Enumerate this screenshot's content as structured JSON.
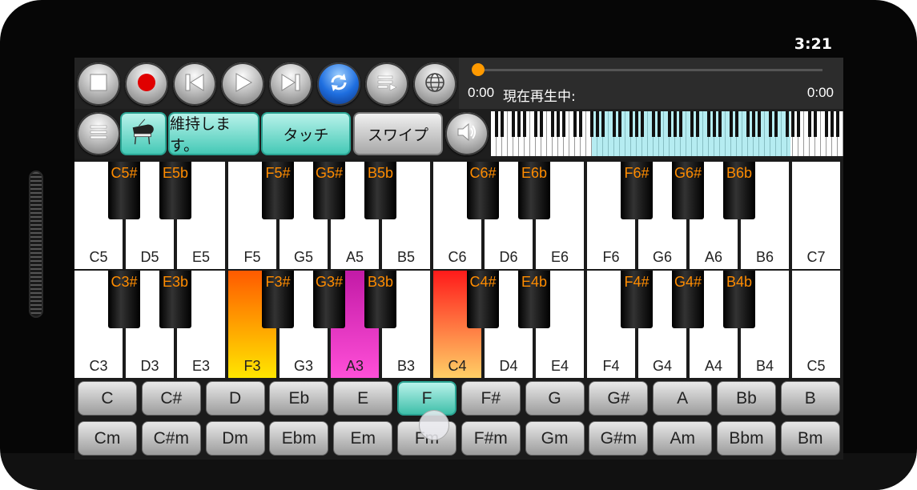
{
  "status_bar": {
    "time": "3:21"
  },
  "toolbar": {
    "buttons": [
      {
        "name": "stop-button",
        "icon": "stop-icon"
      },
      {
        "name": "record-button",
        "icon": "record-icon"
      },
      {
        "name": "previous-button",
        "icon": "skip-previous-icon"
      },
      {
        "name": "play-button",
        "icon": "play-icon"
      },
      {
        "name": "next-button",
        "icon": "skip-next-icon"
      },
      {
        "name": "repeat-button",
        "icon": "repeat-icon"
      },
      {
        "name": "playlist-button",
        "icon": "playlist-icon"
      },
      {
        "name": "web-button",
        "icon": "globe-icon"
      }
    ]
  },
  "player": {
    "time_elapsed": "0:00",
    "now_playing": "現在再生中:",
    "time_total": "0:00",
    "progress": 0
  },
  "controls": {
    "menu_icon": "menu-icon",
    "instrument_icon": "grand-piano-icon",
    "sustain_label": "維持します。",
    "touch_label": "タッチ",
    "swipe_label": "スワイプ",
    "volume_icon": "speaker-icon"
  },
  "keyboard_upper": {
    "white": [
      "C5",
      "D5",
      "E5",
      "F5",
      "G5",
      "A5",
      "B5",
      "C6",
      "D6",
      "E6",
      "F6",
      "G6",
      "A6",
      "B6",
      "C7"
    ],
    "black": [
      {
        "label": "C5#",
        "after": 0
      },
      {
        "label": "E5b",
        "after": 1
      },
      {
        "label": "F5#",
        "after": 3
      },
      {
        "label": "G5#",
        "after": 4
      },
      {
        "label": "B5b",
        "after": 5
      },
      {
        "label": "C6#",
        "after": 7
      },
      {
        "label": "E6b",
        "after": 8
      },
      {
        "label": "F6#",
        "after": 10
      },
      {
        "label": "G6#",
        "after": 11
      },
      {
        "label": "B6b",
        "after": 12
      }
    ]
  },
  "keyboard_lower": {
    "white": [
      "C3",
      "D3",
      "E3",
      "F3",
      "G3",
      "A3",
      "B3",
      "C4",
      "D4",
      "E4",
      "F4",
      "G4",
      "A4",
      "B4",
      "C5"
    ],
    "black": [
      {
        "label": "C3#",
        "after": 0
      },
      {
        "label": "E3b",
        "after": 1
      },
      {
        "label": "F3#",
        "after": 3
      },
      {
        "label": "G3#",
        "after": 4
      },
      {
        "label": "B3b",
        "after": 5
      },
      {
        "label": "C4#",
        "after": 7
      },
      {
        "label": "E4b",
        "after": 8
      },
      {
        "label": "F4#",
        "after": 10
      },
      {
        "label": "G4#",
        "after": 11
      },
      {
        "label": "B4b",
        "after": 12
      }
    ],
    "highlighted": {
      "F3": [
        "#ff5a00",
        "#ffe600"
      ],
      "A3": [
        "#c21aa6",
        "#ff4fd8"
      ],
      "C4": [
        "#ff1a1a",
        "#ffcf66"
      ]
    }
  },
  "chords_major": [
    "C",
    "C#",
    "D",
    "Eb",
    "E",
    "F",
    "F#",
    "G",
    "G#",
    "A",
    "Bb",
    "B"
  ],
  "chords_minor": [
    "Cm",
    "C#m",
    "Dm",
    "Ebm",
    "Em",
    "Fm",
    "F#m",
    "Gm",
    "G#m",
    "Am",
    "Bbm",
    "Bm"
  ],
  "selected_chord": "F",
  "colors": {
    "accent_teal": "#45c9b6",
    "black_key_label": "#ff8c00",
    "progress_dot": "#ff9a00"
  }
}
